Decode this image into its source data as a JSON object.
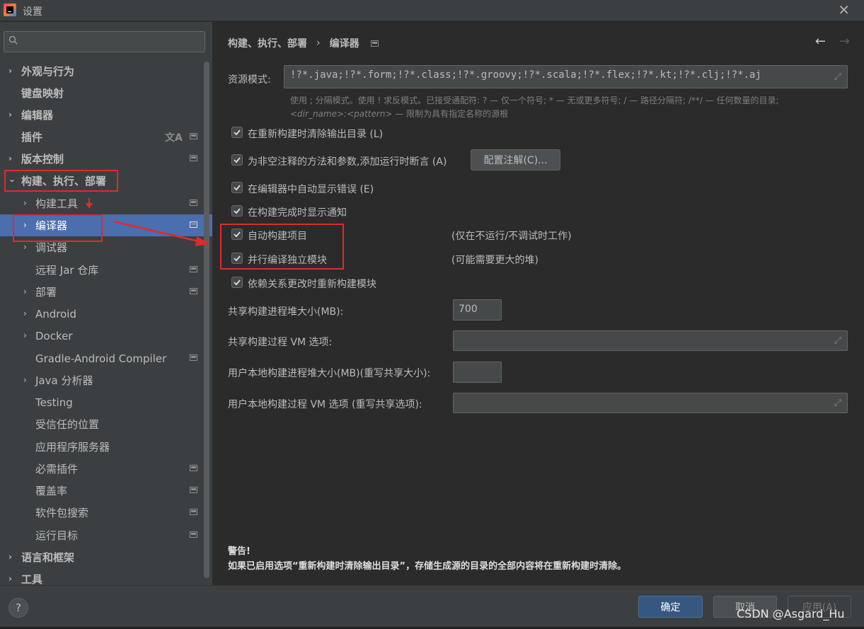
{
  "window": {
    "title": "设置",
    "close_glyph": "✕"
  },
  "sidebar": {
    "search": {
      "value": "",
      "placeholder": ""
    },
    "items": [
      {
        "label": "外观与行为",
        "chevron": "›"
      },
      {
        "label": "键盘映射",
        "chevron": ""
      },
      {
        "label": "编辑器",
        "chevron": "›"
      },
      {
        "label": "插件",
        "chevron": ""
      },
      {
        "label": "版本控制",
        "chevron": "›"
      },
      {
        "label": "构建、执行、部署",
        "chevron": "⌄"
      },
      {
        "label": "构建工具",
        "chevron": "›"
      },
      {
        "label": "编译器",
        "chevron": "›"
      },
      {
        "label": "调试器",
        "chevron": "›"
      },
      {
        "label": "远程 Jar 仓库",
        "chevron": ""
      },
      {
        "label": "部署",
        "chevron": "›"
      },
      {
        "label": "Android",
        "chevron": "›"
      },
      {
        "label": "Docker",
        "chevron": "›"
      },
      {
        "label": "Gradle-Android Compiler",
        "chevron": ""
      },
      {
        "label": "Java 分析器",
        "chevron": "›"
      },
      {
        "label": "Testing",
        "chevron": ""
      },
      {
        "label": "受信任的位置",
        "chevron": ""
      },
      {
        "label": "应用程序服务器",
        "chevron": ""
      },
      {
        "label": "必需插件",
        "chevron": ""
      },
      {
        "label": "覆盖率",
        "chevron": ""
      },
      {
        "label": "软件包搜索",
        "chevron": ""
      },
      {
        "label": "运行目标",
        "chevron": ""
      },
      {
        "label": "语言和框架",
        "chevron": "›"
      },
      {
        "label": "工具",
        "chevron": "›"
      }
    ],
    "translate_glyph": "文A"
  },
  "header": {
    "breadcrumb_parent": "构建、执行、部署",
    "breadcrumb_sep": "›",
    "breadcrumb_current": "编译器",
    "back_glyph": "←",
    "forward_glyph": "→"
  },
  "compiler": {
    "resource_label": "资源模式:",
    "resource_value": "!?*.java;!?*.form;!?*.class;!?*.groovy;!?*.scala;!?*.flex;!?*.kt;!?*.clj;!?*.aj",
    "hint_line1": "使用 ; 分隔模式。使用 ! 求反模式。已接受通配符: ? — 仅一个符号; * — 无或更多符号; / — 路径分隔符; /**/ — 任何数量的目录;",
    "hint_line2_italic": "<dir_name>:<pattern>",
    "hint_line2_rest": " — 限制为具有指定名称的源根",
    "options": [
      {
        "label": "在重新构建时清除输出目录 (L)",
        "checked": true
      },
      {
        "label": "为非空注释的方法和参数,添加运行时断言 (A)",
        "checked": true
      },
      {
        "label": "在编辑器中自动显示错误 (E)",
        "checked": true
      },
      {
        "label": "在构建完成时显示通知",
        "checked": true
      },
      {
        "label": "自动构建项目",
        "checked": true
      },
      {
        "label": "并行编译独立模块",
        "checked": true
      },
      {
        "label": "依赖关系更改时重新构建模块",
        "checked": true
      }
    ],
    "configure_annotations_button": "配置注解(C)...",
    "auto_build_note": "(仅在不运行/不调试时工作)",
    "parallel_note": "(可能需要更大的堆)",
    "heap_label": "共享构建进程堆大小(MB):",
    "heap_value": "700",
    "vm_label": "共享构建过程 VM 选项:",
    "vm_value": "",
    "user_heap_label": "用户本地构建进程堆大小(MB)(重写共享大小):",
    "user_heap_value": "",
    "user_vm_label": "用户本地构建过程 VM 选项 (重写共享选项):",
    "user_vm_value": "",
    "expand_glyph": "⤢"
  },
  "warning": {
    "title": "警告!",
    "text": "如果已启用选项“重新构建时清除输出目录”，存储生成源的目录的全部内容将在重新构建时清除。"
  },
  "footer": {
    "help_glyph": "?",
    "ok_label": "确定",
    "cancel_label": "取消",
    "apply_label": "应用(A)"
  },
  "watermark": "CSDN @Asgard_Hu",
  "colors": {
    "background": "#2b2b2b",
    "panel": "#3c3f41",
    "selection": "#4b6eaf",
    "primary_button": "#365880",
    "annotation_red": "#e12a2a"
  }
}
